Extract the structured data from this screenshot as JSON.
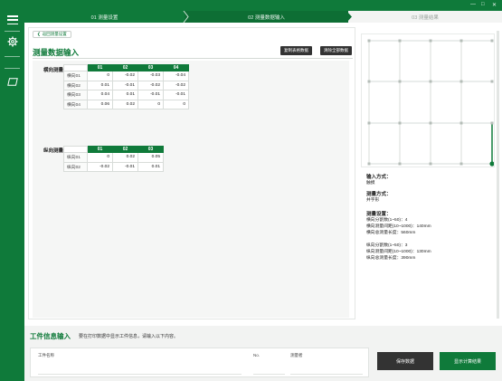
{
  "steps": [
    "01 测量设置",
    "02 测量数据输入",
    "03 测量结果"
  ],
  "window": {
    "minimize": "—",
    "maximize": "□",
    "close": "✕"
  },
  "back_label": "返回测量设置",
  "title": "测量数据输入",
  "buttons": {
    "copy_table": "复制表格数据",
    "clear_all": "清除全部数据"
  },
  "horizontal": {
    "label": "横向测量",
    "columns": [
      "01",
      "02",
      "03",
      "04"
    ],
    "rows": [
      {
        "name": "横向01",
        "values": [
          "0",
          "-0.02",
          "-0.03",
          "-0.04"
        ]
      },
      {
        "name": "横向02",
        "values": [
          "0.01",
          "-0.01",
          "-0.02",
          "-0.02"
        ]
      },
      {
        "name": "横向03",
        "values": [
          "0.04",
          "0.01",
          "-0.01",
          "-0.01"
        ]
      },
      {
        "name": "横向04",
        "values": [
          "0.06",
          "0.02",
          "0",
          "0"
        ]
      }
    ]
  },
  "vertical": {
    "label": "纵向测量",
    "columns": [
      "01",
      "02",
      "03"
    ],
    "rows": [
      {
        "name": "纵向01",
        "values": [
          "0",
          "0.02",
          "0.05"
        ]
      },
      {
        "name": "纵向02",
        "values": [
          "-0.02",
          "-0.01",
          "0.01"
        ]
      }
    ]
  },
  "info": {
    "input_method_label": "输入方式：",
    "input_method_value": "触摸",
    "measure_method_label": "测量方式：",
    "measure_method_value": "井字形",
    "settings_label": "测量设置：",
    "h_lines": [
      "横向分割数(1~50)：4",
      "横向测量间距(10~1000)：140mm",
      "横向总测量长度：560mm"
    ],
    "v_lines": [
      "纵向分割数(1~50)：3",
      "纵向测量间距(10~1000)：130mm",
      "纵向总测量长度：390mm"
    ]
  },
  "workpiece": {
    "title": "工件信息输入",
    "desc": "要在打印数据中显示工件信息，请输入以下内容。",
    "name_label": "工件名称",
    "no_label": "No.",
    "operator_label": "测量者"
  },
  "actions": {
    "save": "保存数据",
    "show_result": "显示计算结果"
  }
}
